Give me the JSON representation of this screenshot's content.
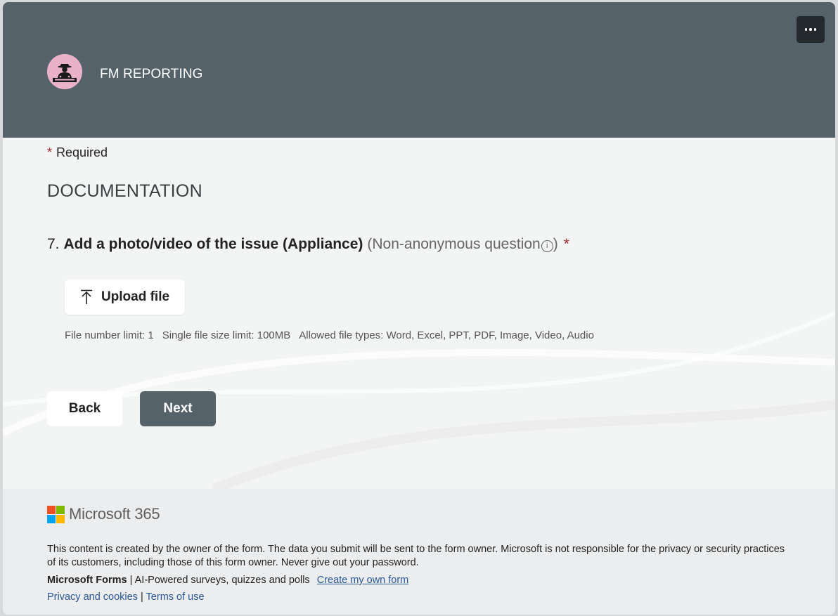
{
  "header": {
    "title": "FM REPORTING",
    "menu_icon": "more-horizontal-icon",
    "background_color": "#56626a"
  },
  "form": {
    "required_star": "*",
    "required_label": "Required",
    "section_title": "DOCUMENTATION",
    "question": {
      "number": "7.",
      "text": "Add a photo/video of the issue (Appliance)",
      "note_open": "(Non-anonymous question",
      "info_glyph": "i",
      "note_close": ")",
      "required_star": "*"
    },
    "upload_button": {
      "label": "Upload file",
      "icon": "upload-arrow-icon"
    },
    "file_limits": {
      "count": "File number limit: 1",
      "size": "Single file size limit: 100MB",
      "types": "Allowed file types: Word, Excel, PPT, PDF, Image, Video, Audio"
    },
    "back_label": "Back",
    "next_label": "Next"
  },
  "footer": {
    "brand": "Microsoft 365",
    "logo_colors": [
      "#f25022",
      "#7fba00",
      "#00a4ef",
      "#ffb900"
    ],
    "disclaimer": "This content is created by the owner of the form. The data you submit will be sent to the form owner. Microsoft is not responsible for the privacy or security practices of its customers, including those of this form owner. Never give out your password.",
    "forms_name": "Microsoft Forms",
    "forms_sep": "|",
    "forms_tagline": "AI-Powered surveys, quizzes and polls",
    "create_link": "Create my own form",
    "privacy_link": "Privacy and cookies",
    "links_sep": "|",
    "terms_link": "Terms of use"
  }
}
